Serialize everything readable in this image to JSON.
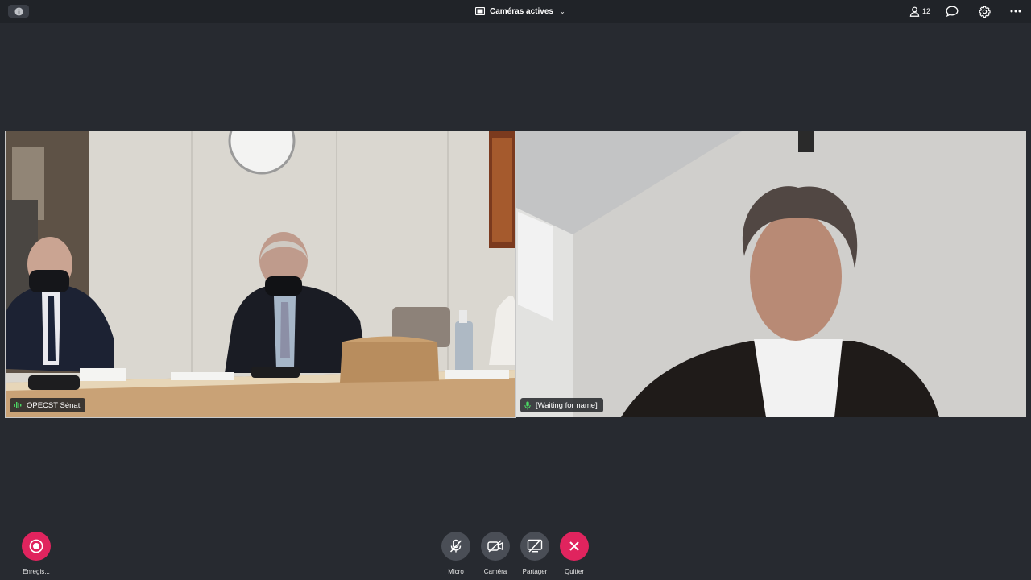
{
  "topbar": {
    "layout_label": "Caméras actives",
    "participant_count": "12"
  },
  "tiles": [
    {
      "name": "OPECST Sénat"
    },
    {
      "name": "[Waiting for name]"
    }
  ],
  "controls": {
    "record_label": "Enregis...",
    "mic_label": "Micro",
    "camera_label": "Caméra",
    "share_label": "Partager",
    "quit_label": "Quitter"
  },
  "colors": {
    "background": "#272a30",
    "accent_red": "#e0245e",
    "control_grey": "#4a4e56",
    "speaking_green": "#4cd964"
  },
  "icons": {
    "info": "info-icon",
    "layout": "camera-grid-icon",
    "participants": "person-icon",
    "chat": "chat-bubble-icon",
    "settings": "gear-icon",
    "more": "ellipsis-icon",
    "mic_off": "microphone-off-icon",
    "cam_off": "camera-off-icon",
    "share_off": "screen-share-off-icon",
    "quit": "close-icon",
    "record": "record-icon"
  }
}
